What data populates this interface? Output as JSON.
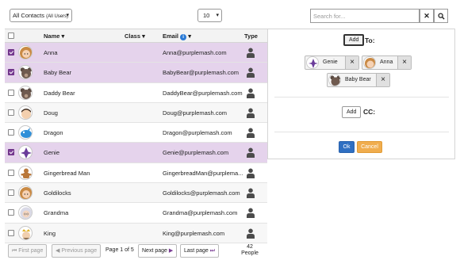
{
  "toolbar": {
    "contacts_filter": "All Contacts",
    "contacts_filter_sub": "(All Users)",
    "page_size": "10",
    "search_placeholder": "Search for...",
    "clear_label": "✕",
    "search_icon": "search-icon"
  },
  "table": {
    "headers": {
      "name": "Name",
      "class": "Class",
      "email": "Email",
      "type": "Type"
    },
    "rows": [
      {
        "name": "Anna",
        "email": "Anna@purplemash.com",
        "selected": true,
        "avatar": "girl-avatar"
      },
      {
        "name": "Baby Bear",
        "email": "BabyBear@purplemash.com",
        "selected": true,
        "avatar": "bear-avatar"
      },
      {
        "name": "Daddy Bear",
        "email": "DaddyBear@purplemash.com",
        "selected": false,
        "avatar": "bear-avatar"
      },
      {
        "name": "Doug",
        "email": "Doug@purplemash.com",
        "selected": false,
        "avatar": "boy-avatar"
      },
      {
        "name": "Dragon",
        "email": "Dragon@purplemash.com",
        "selected": false,
        "avatar": "dragon-avatar"
      },
      {
        "name": "Genie",
        "email": "Genie@purplemash.com",
        "selected": true,
        "avatar": "genie-avatar"
      },
      {
        "name": "Gingerbread Man",
        "email": "GingerbreadMan@purplema...",
        "selected": false,
        "avatar": "gingerbread-avatar"
      },
      {
        "name": "Goldilocks",
        "email": "Goldilocks@purplemash.com",
        "selected": false,
        "avatar": "girl-avatar"
      },
      {
        "name": "Grandma",
        "email": "Grandma@purplemash.com",
        "selected": false,
        "avatar": "grandma-avatar"
      },
      {
        "name": "King",
        "email": "King@purplemash.com",
        "selected": false,
        "avatar": "king-avatar"
      }
    ]
  },
  "pager": {
    "first": "First page",
    "previous": "Previous page",
    "info": "Page 1 of 5",
    "next": "Next page",
    "last": "Last page",
    "count": "42",
    "count_label": "People"
  },
  "panel": {
    "add_label": "Add",
    "to_label": "To:",
    "cc_label": "CC:",
    "recipients": [
      {
        "name": "Genie",
        "avatar": "genie-avatar"
      },
      {
        "name": "Anna",
        "avatar": "girl-avatar"
      },
      {
        "name": "Baby Bear",
        "avatar": "bear-avatar"
      }
    ],
    "ok_label": "Ok",
    "cancel_label": "Cancel"
  },
  "colors": {
    "selected_row": "#e5d3ec",
    "ok": "#2f6fc2",
    "cancel": "#f0ad4e",
    "info_icon": "#2b7bd6"
  }
}
